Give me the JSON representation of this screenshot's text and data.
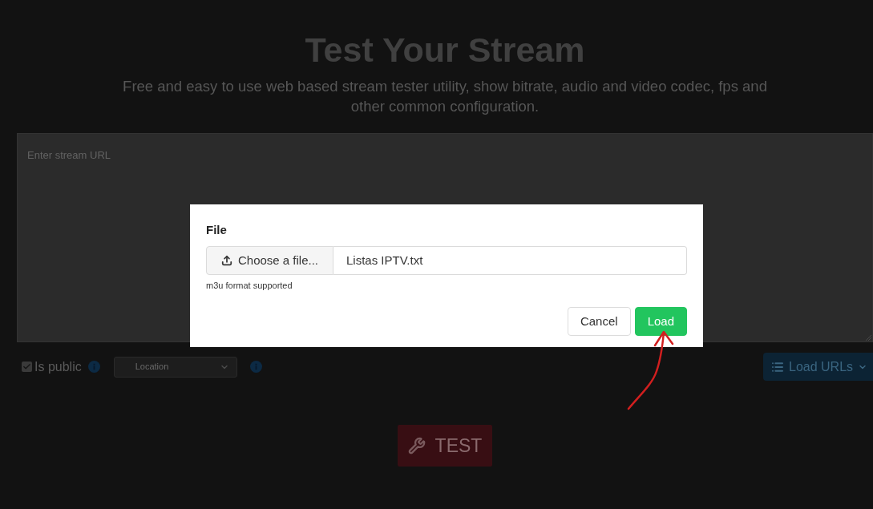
{
  "page": {
    "title": "Test Your Stream",
    "subtitle": "Free and easy to use web based stream tester utility, show bitrate, audio and video codec, fps and other common configuration."
  },
  "stream_input": {
    "placeholder": "Enter stream URL"
  },
  "options": {
    "is_public": {
      "label": "Is public",
      "checked": true
    },
    "location": {
      "value": "Location"
    },
    "load_urls": {
      "label": "Load URLs"
    }
  },
  "test_button": {
    "label": "TEST"
  },
  "modal": {
    "field_label": "File",
    "choose_button": "Choose a file...",
    "file_name": "Listas IPTV.txt",
    "help": "m3u format supported",
    "buttons": [
      {
        "label": "Cancel",
        "kind": "secondary"
      },
      {
        "label": "Load",
        "kind": "primary"
      }
    ]
  }
}
